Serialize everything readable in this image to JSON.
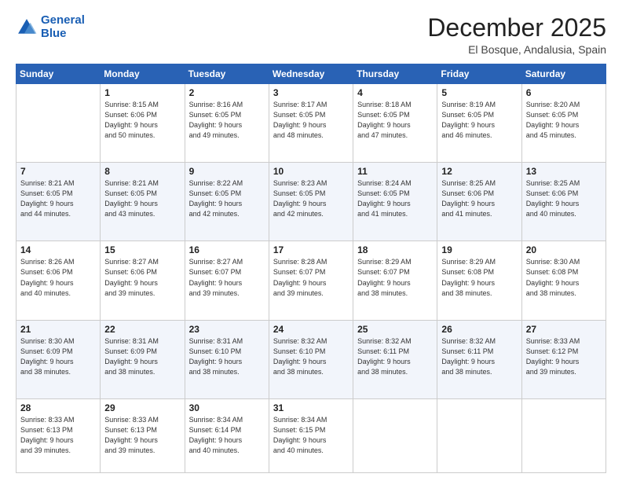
{
  "logo": {
    "line1": "General",
    "line2": "Blue"
  },
  "title": "December 2025",
  "location": "El Bosque, Andalusia, Spain",
  "weekdays": [
    "Sunday",
    "Monday",
    "Tuesday",
    "Wednesday",
    "Thursday",
    "Friday",
    "Saturday"
  ],
  "weeks": [
    [
      {
        "day": "",
        "detail": ""
      },
      {
        "day": "1",
        "detail": "Sunrise: 8:15 AM\nSunset: 6:06 PM\nDaylight: 9 hours\nand 50 minutes."
      },
      {
        "day": "2",
        "detail": "Sunrise: 8:16 AM\nSunset: 6:05 PM\nDaylight: 9 hours\nand 49 minutes."
      },
      {
        "day": "3",
        "detail": "Sunrise: 8:17 AM\nSunset: 6:05 PM\nDaylight: 9 hours\nand 48 minutes."
      },
      {
        "day": "4",
        "detail": "Sunrise: 8:18 AM\nSunset: 6:05 PM\nDaylight: 9 hours\nand 47 minutes."
      },
      {
        "day": "5",
        "detail": "Sunrise: 8:19 AM\nSunset: 6:05 PM\nDaylight: 9 hours\nand 46 minutes."
      },
      {
        "day": "6",
        "detail": "Sunrise: 8:20 AM\nSunset: 6:05 PM\nDaylight: 9 hours\nand 45 minutes."
      }
    ],
    [
      {
        "day": "7",
        "detail": "Sunrise: 8:21 AM\nSunset: 6:05 PM\nDaylight: 9 hours\nand 44 minutes."
      },
      {
        "day": "8",
        "detail": "Sunrise: 8:21 AM\nSunset: 6:05 PM\nDaylight: 9 hours\nand 43 minutes."
      },
      {
        "day": "9",
        "detail": "Sunrise: 8:22 AM\nSunset: 6:05 PM\nDaylight: 9 hours\nand 42 minutes."
      },
      {
        "day": "10",
        "detail": "Sunrise: 8:23 AM\nSunset: 6:05 PM\nDaylight: 9 hours\nand 42 minutes."
      },
      {
        "day": "11",
        "detail": "Sunrise: 8:24 AM\nSunset: 6:05 PM\nDaylight: 9 hours\nand 41 minutes."
      },
      {
        "day": "12",
        "detail": "Sunrise: 8:25 AM\nSunset: 6:06 PM\nDaylight: 9 hours\nand 41 minutes."
      },
      {
        "day": "13",
        "detail": "Sunrise: 8:25 AM\nSunset: 6:06 PM\nDaylight: 9 hours\nand 40 minutes."
      }
    ],
    [
      {
        "day": "14",
        "detail": "Sunrise: 8:26 AM\nSunset: 6:06 PM\nDaylight: 9 hours\nand 40 minutes."
      },
      {
        "day": "15",
        "detail": "Sunrise: 8:27 AM\nSunset: 6:06 PM\nDaylight: 9 hours\nand 39 minutes."
      },
      {
        "day": "16",
        "detail": "Sunrise: 8:27 AM\nSunset: 6:07 PM\nDaylight: 9 hours\nand 39 minutes."
      },
      {
        "day": "17",
        "detail": "Sunrise: 8:28 AM\nSunset: 6:07 PM\nDaylight: 9 hours\nand 39 minutes."
      },
      {
        "day": "18",
        "detail": "Sunrise: 8:29 AM\nSunset: 6:07 PM\nDaylight: 9 hours\nand 38 minutes."
      },
      {
        "day": "19",
        "detail": "Sunrise: 8:29 AM\nSunset: 6:08 PM\nDaylight: 9 hours\nand 38 minutes."
      },
      {
        "day": "20",
        "detail": "Sunrise: 8:30 AM\nSunset: 6:08 PM\nDaylight: 9 hours\nand 38 minutes."
      }
    ],
    [
      {
        "day": "21",
        "detail": "Sunrise: 8:30 AM\nSunset: 6:09 PM\nDaylight: 9 hours\nand 38 minutes."
      },
      {
        "day": "22",
        "detail": "Sunrise: 8:31 AM\nSunset: 6:09 PM\nDaylight: 9 hours\nand 38 minutes."
      },
      {
        "day": "23",
        "detail": "Sunrise: 8:31 AM\nSunset: 6:10 PM\nDaylight: 9 hours\nand 38 minutes."
      },
      {
        "day": "24",
        "detail": "Sunrise: 8:32 AM\nSunset: 6:10 PM\nDaylight: 9 hours\nand 38 minutes."
      },
      {
        "day": "25",
        "detail": "Sunrise: 8:32 AM\nSunset: 6:11 PM\nDaylight: 9 hours\nand 38 minutes."
      },
      {
        "day": "26",
        "detail": "Sunrise: 8:32 AM\nSunset: 6:11 PM\nDaylight: 9 hours\nand 38 minutes."
      },
      {
        "day": "27",
        "detail": "Sunrise: 8:33 AM\nSunset: 6:12 PM\nDaylight: 9 hours\nand 39 minutes."
      }
    ],
    [
      {
        "day": "28",
        "detail": "Sunrise: 8:33 AM\nSunset: 6:13 PM\nDaylight: 9 hours\nand 39 minutes."
      },
      {
        "day": "29",
        "detail": "Sunrise: 8:33 AM\nSunset: 6:13 PM\nDaylight: 9 hours\nand 39 minutes."
      },
      {
        "day": "30",
        "detail": "Sunrise: 8:34 AM\nSunset: 6:14 PM\nDaylight: 9 hours\nand 40 minutes."
      },
      {
        "day": "31",
        "detail": "Sunrise: 8:34 AM\nSunset: 6:15 PM\nDaylight: 9 hours\nand 40 minutes."
      },
      {
        "day": "",
        "detail": ""
      },
      {
        "day": "",
        "detail": ""
      },
      {
        "day": "",
        "detail": ""
      }
    ]
  ]
}
